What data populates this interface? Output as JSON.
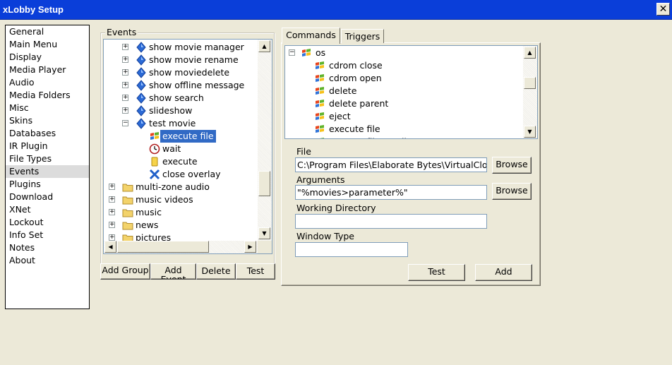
{
  "window": {
    "title": "xLobby Setup"
  },
  "categories": [
    {
      "label": "General"
    },
    {
      "label": "Main Menu"
    },
    {
      "label": "Display"
    },
    {
      "label": "Media Player"
    },
    {
      "label": "Audio"
    },
    {
      "label": "Media Folders"
    },
    {
      "label": "Misc"
    },
    {
      "label": "Skins"
    },
    {
      "label": "Databases"
    },
    {
      "label": "IR Plugin"
    },
    {
      "label": "File Types"
    },
    {
      "label": "Events",
      "selected": true
    },
    {
      "label": "Plugins"
    },
    {
      "label": "Download"
    },
    {
      "label": "XNet"
    },
    {
      "label": "Lockout"
    },
    {
      "label": "Info Set"
    },
    {
      "label": "Notes"
    },
    {
      "label": "About"
    }
  ],
  "events": {
    "group_label": "Events",
    "tree": [
      {
        "label": "show movie manager",
        "icon": "diamond-icon"
      },
      {
        "label": "show movie rename",
        "icon": "diamond-icon"
      },
      {
        "label": "show moviedelete",
        "icon": "diamond-icon"
      },
      {
        "label": "show offline message",
        "icon": "diamond-icon"
      },
      {
        "label": "show search",
        "icon": "diamond-icon"
      },
      {
        "label": "slideshow",
        "icon": "diamond-icon"
      },
      {
        "label": "test movie",
        "icon": "diamond-icon"
      },
      {
        "label": "execute file",
        "icon": "windows-flag-icon"
      },
      {
        "label": "wait",
        "icon": "clock-icon"
      },
      {
        "label": "execute",
        "icon": "document-icon"
      },
      {
        "label": "close overlay",
        "icon": "x-icon"
      },
      {
        "label": "multi-zone audio",
        "icon": "folder-icon"
      },
      {
        "label": "music videos",
        "icon": "folder-icon"
      },
      {
        "label": "music",
        "icon": "folder-icon"
      },
      {
        "label": "news",
        "icon": "folder-icon"
      },
      {
        "label": "pictures",
        "icon": "folder-icon"
      }
    ],
    "buttons": {
      "add_group": "Add Group",
      "add_event": "Add Event",
      "delete": "Delete",
      "test": "Test"
    }
  },
  "tabs": [
    {
      "label": "Commands",
      "active": true
    },
    {
      "label": "Triggers"
    }
  ],
  "commands": {
    "tree": [
      {
        "label": "os",
        "icon": "windows-flag-icon"
      },
      {
        "label": "cdrom close",
        "icon": "windows-flag-icon"
      },
      {
        "label": "cdrom open",
        "icon": "windows-flag-icon"
      },
      {
        "label": "delete",
        "icon": "windows-flag-icon"
      },
      {
        "label": "delete parent",
        "icon": "windows-flag-icon"
      },
      {
        "label": "eject",
        "icon": "windows-flag-icon"
      },
      {
        "label": "execute file",
        "icon": "windows-flag-icon"
      },
      {
        "label": "execute file no client",
        "icon": "windows-flag-icon"
      }
    ],
    "file": {
      "label": "File",
      "value": "C:\\Program Files\\Elaborate Bytes\\VirtualClo",
      "browse": "Browse"
    },
    "arguments": {
      "label": "Arguments",
      "value": "\"%movies>parameter%\"",
      "browse": "Browse"
    },
    "working_dir": {
      "label": "Working Directory",
      "value": ""
    },
    "window_type": {
      "label": "Window Type",
      "value": ""
    },
    "test_button": "Test",
    "add_button": "Add"
  },
  "colors": {
    "titlebar": "#0a3ed9",
    "selection": "#316ac5",
    "window_bg": "#ece9d8",
    "diamond": "#2b6ad6",
    "folder": "#f3d36b"
  }
}
